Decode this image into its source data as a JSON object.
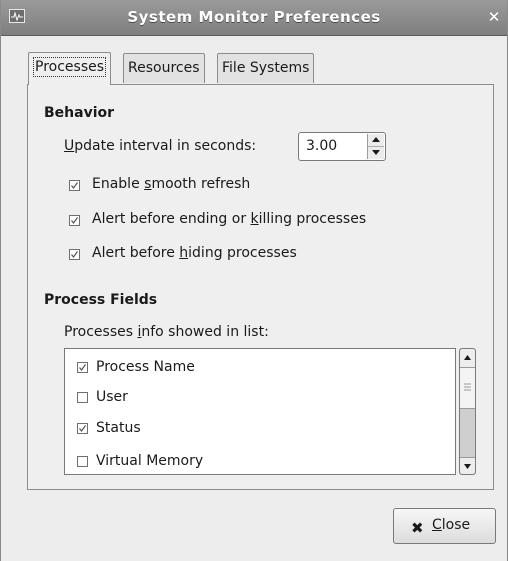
{
  "window": {
    "title": "System Monitor Preferences",
    "close_glyph": "✕",
    "icon": "system-monitor-icon"
  },
  "tabs": [
    {
      "label": "Processes",
      "selected": true
    },
    {
      "label": "Resources",
      "selected": false
    },
    {
      "label": "File Systems",
      "selected": false
    }
  ],
  "behavior": {
    "heading": "Behavior",
    "update_interval_label": "Update interval in seconds:",
    "update_interval_mnemonic": "U",
    "update_interval_rest": "pdate interval in seconds:",
    "update_interval_value": "3.00",
    "options": [
      {
        "pre": "Enable ",
        "mn": "s",
        "post": "mooth refresh",
        "checked": true
      },
      {
        "pre": "Alert before ending or ",
        "mn": "k",
        "post": "illing processes",
        "checked": true
      },
      {
        "pre": "Alert before ",
        "mn": "h",
        "post": "iding processes",
        "checked": true
      }
    ]
  },
  "process_fields": {
    "heading": "Process Fields",
    "list_label_pre": "Processes ",
    "list_label_mn": "i",
    "list_label_post": "nfo showed in list:",
    "items": [
      {
        "label": "Process Name",
        "checked": true
      },
      {
        "label": "User",
        "checked": false
      },
      {
        "label": "Status",
        "checked": true
      },
      {
        "label": "Virtual Memory",
        "checked": false
      }
    ]
  },
  "footer": {
    "close_icon": "x-icon",
    "close_glyph": "✖",
    "close_mn": "C",
    "close_rest": "lose"
  }
}
